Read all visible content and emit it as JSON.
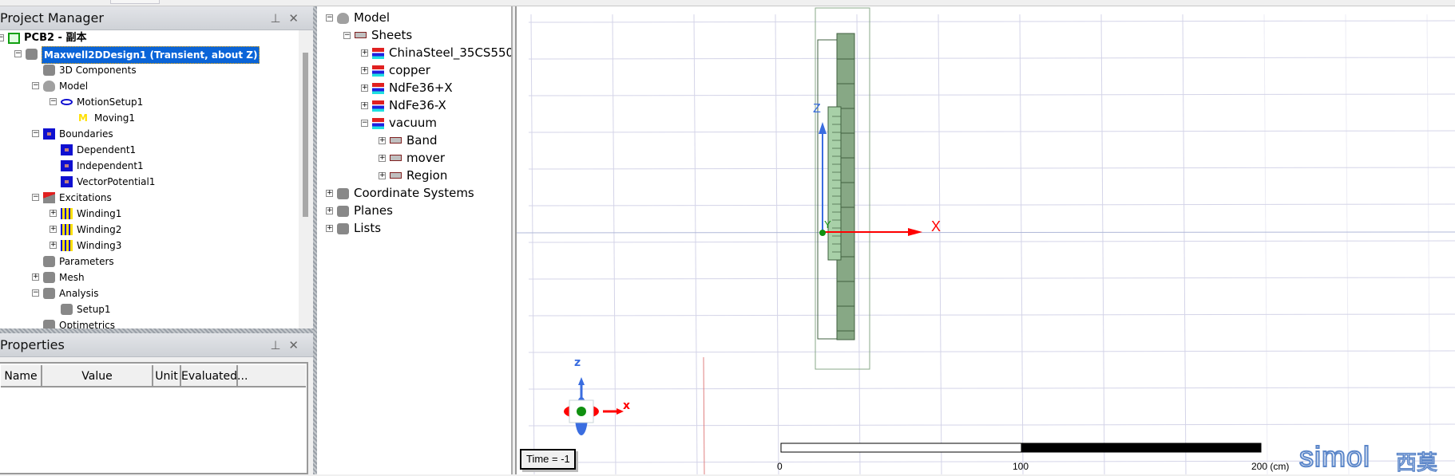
{
  "project_manager": {
    "title": "Project Manager",
    "pin_icon": "pin-icon",
    "close_icon": "close-icon",
    "tree": [
      {
        "level": 0,
        "label": "PCB2 - 副本",
        "icon": "project-icon",
        "exp": "-",
        "style": "bold"
      },
      {
        "level": 1,
        "label": "Maxwell2DDesign1 (Transient, about Z)",
        "icon": "design-icon",
        "exp": "-",
        "style": "sel"
      },
      {
        "level": 2,
        "label": "3D Components",
        "icon": "3d-components-icon",
        "exp": ""
      },
      {
        "level": 2,
        "label": "Model",
        "icon": "model-icon",
        "exp": "-"
      },
      {
        "level": 3,
        "label": "MotionSetup1",
        "icon": "motion-setup-icon",
        "exp": "-"
      },
      {
        "level": 4,
        "label": "Moving1",
        "icon": "moving-icon",
        "exp": ""
      },
      {
        "level": 2,
        "label": "Boundaries",
        "icon": "boundaries-icon",
        "exp": "-"
      },
      {
        "level": 3,
        "label": "Dependent1",
        "icon": "boundary-icon",
        "exp": ""
      },
      {
        "level": 3,
        "label": "Independent1",
        "icon": "boundary-icon",
        "exp": ""
      },
      {
        "level": 3,
        "label": "VectorPotential1",
        "icon": "boundary-icon",
        "exp": ""
      },
      {
        "level": 2,
        "label": "Excitations",
        "icon": "excitations-icon",
        "exp": "-"
      },
      {
        "level": 3,
        "label": "Winding1",
        "icon": "winding-icon",
        "exp": "+"
      },
      {
        "level": 3,
        "label": "Winding2",
        "icon": "winding-icon",
        "exp": "+"
      },
      {
        "level": 3,
        "label": "Winding3",
        "icon": "winding-icon",
        "exp": "+"
      },
      {
        "level": 2,
        "label": "Parameters",
        "icon": "parameters-icon",
        "exp": ""
      },
      {
        "level": 2,
        "label": "Mesh",
        "icon": "mesh-icon",
        "exp": "+"
      },
      {
        "level": 2,
        "label": "Analysis",
        "icon": "analysis-icon",
        "exp": "-"
      },
      {
        "level": 3,
        "label": "Setup1",
        "icon": "setup-icon",
        "exp": ""
      },
      {
        "level": 2,
        "label": "Optimetrics",
        "icon": "optimetrics-icon",
        "exp": ""
      }
    ]
  },
  "properties": {
    "title": "Properties",
    "columns": [
      "Name",
      "Value",
      "Unit",
      "Evaluated..."
    ]
  },
  "model_tree": [
    {
      "level": 0,
      "label": "Model",
      "icon": "model-icon",
      "exp": "-"
    },
    {
      "level": 1,
      "label": "Sheets",
      "icon": "sheet-icon",
      "exp": "-"
    },
    {
      "level": 2,
      "label": "ChinaSteel_35CS550",
      "icon": "material-icon",
      "exp": "+"
    },
    {
      "level": 2,
      "label": "copper",
      "icon": "material-icon",
      "exp": "+"
    },
    {
      "level": 2,
      "label": "NdFe36+X",
      "icon": "material-icon",
      "exp": "+"
    },
    {
      "level": 2,
      "label": "NdFe36-X",
      "icon": "material-icon",
      "exp": "+"
    },
    {
      "level": 2,
      "label": "vacuum",
      "icon": "material-icon",
      "exp": "-"
    },
    {
      "level": 3,
      "label": "Band",
      "icon": "sheet-icon",
      "exp": "+"
    },
    {
      "level": 3,
      "label": "mover",
      "icon": "sheet-icon",
      "exp": "+"
    },
    {
      "level": 3,
      "label": "Region",
      "icon": "sheet-icon",
      "exp": "+"
    },
    {
      "level": 0,
      "label": "Coordinate Systems",
      "icon": "coordinate-systems-icon",
      "exp": "+"
    },
    {
      "level": 0,
      "label": "Planes",
      "icon": "planes-icon",
      "exp": "+"
    },
    {
      "level": 0,
      "label": "Lists",
      "icon": "lists-icon",
      "exp": "+"
    }
  ],
  "viewport": {
    "axis_z": "Z",
    "axis_x": "X",
    "axis_y": "Y",
    "triad_z": "z",
    "triad_x": "x",
    "time_label": "Time = -1",
    "scale": {
      "start": "0",
      "mid": "100",
      "end": "200 (cm)"
    },
    "colors": {
      "grid": "#d4d4e8",
      "steel": "#87a885",
      "magnet": "#a8d0a8",
      "x_axis": "#ff0000",
      "z_axis": "#3a6de0",
      "origin": "#109010"
    }
  },
  "watermark": {
    "text": "simol",
    "cn": "西莫"
  }
}
